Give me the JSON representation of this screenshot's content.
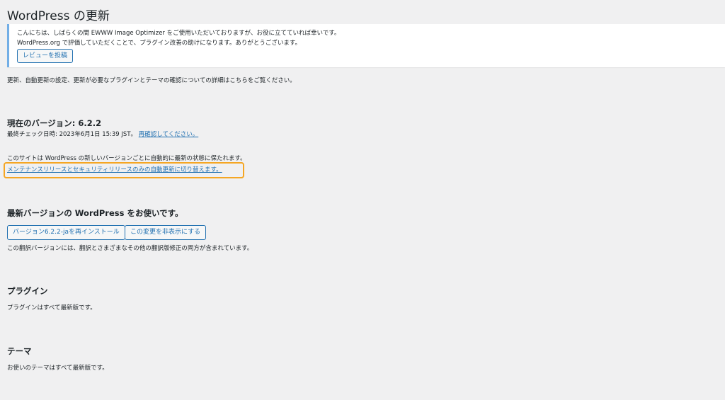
{
  "page": {
    "title": "WordPress の更新"
  },
  "notice": {
    "line1": "こんにちは、しばらくの間 EWWW Image Optimizer をご使用いただいておりますが、お役に立てていれば幸いです。",
    "line2": "WordPress.org で評価していただくことで、プラグイン改善の助けになります。ありがとうございます。",
    "button_label": "レビューを投稿"
  },
  "intro_text": "更新、自動更新の設定、更新が必要なプラグインとテーマの確認についての詳細はこちらをご覧ください。",
  "current_version": {
    "heading": "現在のバージョン: 6.2.2",
    "last_checked": "最終チェック日時: 2023年6月1日 15:39 JST。",
    "recheck_link": "再確認してください。",
    "auto_update_text": "このサイトは WordPress の新しいバージョンごとに自動的に最新の状態に保たれます。",
    "switch_link": "メンテナンスリリースとセキュリティリリースのみの自動更新に切り替えます。"
  },
  "latest": {
    "heading": "最新バージョンの WordPress をお使いです。",
    "reinstall_button": "バージョン6.2.2-jaを再インストール",
    "hide_button": "この変更を非表示にする",
    "note": "この翻訳バージョンには、翻訳とさまざまなその他の翻訳版修正の両方が含まれています。"
  },
  "plugins": {
    "heading": "プラグイン",
    "status": "プラグインはすべて最新版です。"
  },
  "themes": {
    "heading": "テーマ",
    "status": "お使いのテーマはすべて最新版です。"
  },
  "colors": {
    "link": "#2271b1",
    "highlight_border": "#f5a623",
    "notice_border": "#72aee6",
    "background": "#f0f0f1"
  }
}
